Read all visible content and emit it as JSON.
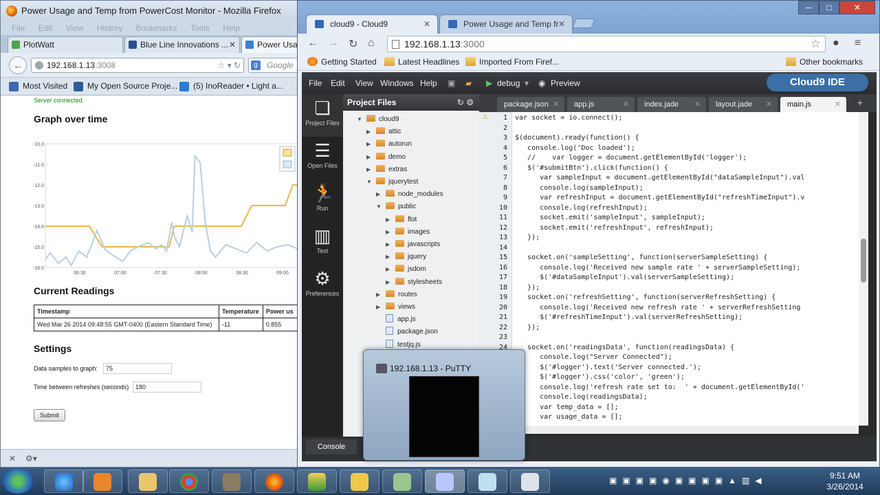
{
  "firefox": {
    "title": "Power Usage and Temp from PowerCost Monitor - Mozilla Firefox",
    "menu": [
      "File",
      "Edit",
      "View",
      "History",
      "Bookmarks",
      "Tools",
      "Help"
    ],
    "tabs": [
      "PlotWatt",
      "Blue Line Innovations ...",
      "Power Usag"
    ],
    "url_host": "192.168.1.13",
    "url_port": ":3008",
    "search_placeholder": "Google",
    "bookmarks": [
      "Most Visited",
      "My Open Source Proje...",
      "(5) InoReader • Light a..."
    ]
  },
  "page": {
    "server_status": "Server connected.",
    "graph_heading": "Graph over time",
    "readings_heading": "Current Readings",
    "settings_heading": "Settings",
    "table": {
      "headers": [
        "Timestamp",
        "Temperature",
        "Power us"
      ],
      "row": [
        "Wed Mar 26 2014 09:48:55 GMT-0400 (Eastern Standard Time)",
        "-11",
        "0.855"
      ]
    },
    "samples_label": "Data samples to graph:",
    "samples_value": "75",
    "refresh_label": "Time between refreshes (seconds)",
    "refresh_value": "180",
    "submit_label": "Submit"
  },
  "chart_data": {
    "type": "line",
    "ylim": [
      -16.0,
      -10.0
    ],
    "yticks": [
      "-10.0",
      "-11.0",
      "-12.0",
      "-13.0",
      "-14.0",
      "-15.0",
      "-16.0"
    ],
    "xticks": [
      "06:30",
      "07:00",
      "07:30",
      "08:00",
      "08:30",
      "09:00"
    ],
    "series": [
      {
        "color": "#e8b84a",
        "x": [
          0,
          0.17,
          0.22,
          0.48,
          0.5,
          0.55,
          0.73,
          0.76,
          0.8,
          0.93,
          0.96,
          1.0
        ],
        "values": [
          -14,
          -14,
          -15,
          -15,
          -14,
          -14,
          -14,
          -14,
          -13,
          -13,
          -12,
          -12
        ]
      },
      {
        "color": "#b9cde6",
        "x": [
          0,
          0.02,
          0.05,
          0.08,
          0.1,
          0.13,
          0.16,
          0.18,
          0.2,
          0.23,
          0.26,
          0.3,
          0.33,
          0.36,
          0.4,
          0.43,
          0.45,
          0.47,
          0.49,
          0.5,
          0.52,
          0.55,
          0.57,
          0.58,
          0.6,
          0.62,
          0.64,
          0.66,
          0.7,
          0.74,
          0.78,
          0.82,
          0.86,
          0.9,
          0.94,
          0.98,
          1.0
        ],
        "values": [
          -15.6,
          -15.3,
          -15.8,
          -15.5,
          -15.9,
          -15.2,
          -15.5,
          -14.9,
          -14.2,
          -15.1,
          -15.4,
          -15.7,
          -15.2,
          -15.0,
          -14.8,
          -15.1,
          -14.9,
          -15.2,
          -13.8,
          -14.5,
          -15.0,
          -13.5,
          -14.3,
          -10.6,
          -10.9,
          -13.8,
          -15.2,
          -15.5,
          -14.9,
          -15.1,
          -15.3,
          -14.8,
          -15.2,
          -15.0,
          -14.9,
          -15.1,
          -15.0
        ]
      }
    ]
  },
  "chrome": {
    "tabs": [
      "cloud9 - Cloud9",
      "Power Usage and Temp fr"
    ],
    "url_host": "192.168.1.13",
    "url_port": ":3000",
    "bookmarks": [
      "Getting Started",
      "Latest Headlines",
      "Imported From Firef...",
      "Other bookmarks"
    ]
  },
  "cloud9": {
    "menu": [
      "File",
      "Edit",
      "View",
      "Windows",
      "Help"
    ],
    "debug_label": "debug",
    "preview_label": "Preview",
    "logo": "Cloud9 IDE",
    "sidebar": [
      "Project Files",
      "Open Files",
      "Run",
      "Test",
      "Preferences"
    ],
    "tree_title": "Project Files",
    "tree": [
      {
        "name": "cloud9",
        "type": "folder",
        "depth": 0,
        "open": true
      },
      {
        "name": "attic",
        "type": "folder",
        "depth": 1,
        "open": false
      },
      {
        "name": "autorun",
        "type": "folder",
        "depth": 1,
        "open": false
      },
      {
        "name": "demo",
        "type": "folder",
        "depth": 1,
        "open": false
      },
      {
        "name": "extras",
        "type": "folder",
        "depth": 1,
        "open": false
      },
      {
        "name": "jquerytest",
        "type": "folder",
        "depth": 1,
        "open": true
      },
      {
        "name": "node_modules",
        "type": "folder",
        "depth": 2,
        "open": false
      },
      {
        "name": "public",
        "type": "folder",
        "depth": 2,
        "open": true
      },
      {
        "name": "flot",
        "type": "folder",
        "depth": 3,
        "open": false
      },
      {
        "name": "images",
        "type": "folder",
        "depth": 3,
        "open": false
      },
      {
        "name": "javascripts",
        "type": "folder",
        "depth": 3,
        "open": false
      },
      {
        "name": "jquery",
        "type": "folder",
        "depth": 3,
        "open": false
      },
      {
        "name": "jsdom",
        "type": "folder",
        "depth": 3,
        "open": false
      },
      {
        "name": "stylesheets",
        "type": "folder",
        "depth": 3,
        "open": false
      },
      {
        "name": "routes",
        "type": "folder",
        "depth": 2,
        "open": false
      },
      {
        "name": "views",
        "type": "folder",
        "depth": 2,
        "open": false
      },
      {
        "name": "app.js",
        "type": "file",
        "depth": 2
      },
      {
        "name": "package.json",
        "type": "file",
        "depth": 2
      },
      {
        "name": "testjq.js",
        "type": "file",
        "depth": 2
      }
    ],
    "editor_tabs": [
      "package.json",
      "app.js",
      "index.jade",
      "layout.jade",
      "main.js"
    ],
    "active_tab": "main.js",
    "code": [
      "var socket = io.connect();",
      "",
      "$(document).ready(function() {",
      "   console.log('Doc loaded');",
      "   //    var logger = document.getElementById('logger');",
      "   $('#submitBtn').click(function() {",
      "      var sampleInput = document.getElementById(\"dataSampleInput\").val",
      "      console.log(sampleInput);",
      "      var refreshInput = document.getElementById(\"refreshTimeInput\").v",
      "      console.log(refreshInput);",
      "      socket.emit('sampleInput', sampleInput);",
      "      socket.emit('refreshInput', refreshInput);",
      "   });",
      "",
      "   socket.on('sampleSetting', function(serverSampleSetting) {",
      "      console.log('Received new sample rate ' + serverSampleSetting);",
      "      $('#dataSampleInput').val(serverSampleSetting);",
      "   });",
      "   socket.on('refreshSetting', function(serverRefreshSetting) {",
      "      console.log('Received new refresh rate ' + serverRefreshSetting",
      "      $('#refreshTimeInput').val(serverRefreshSetting);",
      "   });",
      "",
      "   socket.on('readingsData', function(readingsData) {",
      "      console.log(\"Server Connected\");",
      "      $('#logger').text('Server connected.');",
      "      $('#logger').css('color', 'green');",
      "      console.log('refresh rate set to:  ' + document.getElementById('",
      "      console.log(readingsData);",
      "      var temp_data = [];",
      "      var usage_data = [];"
    ],
    "console_label": "Console"
  },
  "putty": {
    "title": "192.168.1.13 - PuTTY"
  },
  "taskbar": {
    "time": "9:51 AM",
    "date": "3/26/2014"
  }
}
